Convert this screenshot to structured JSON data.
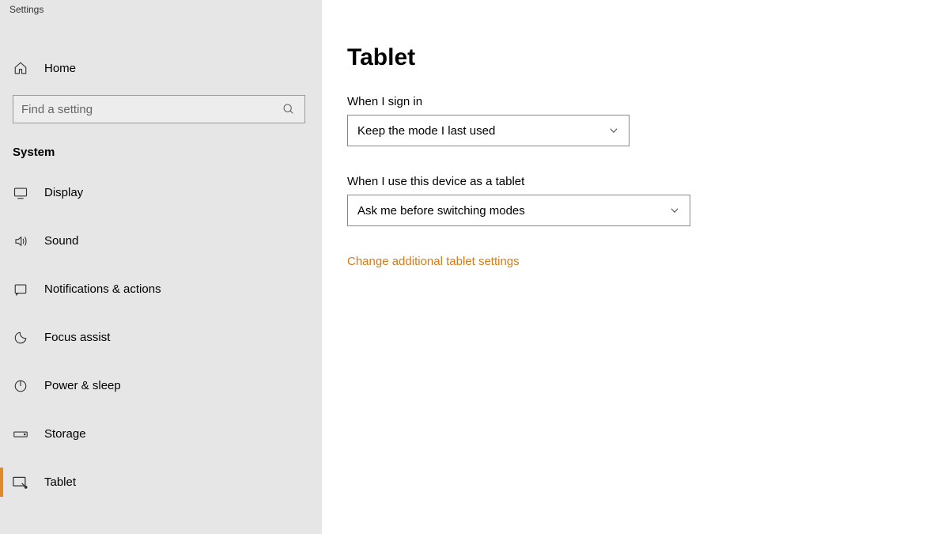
{
  "window": {
    "title": "Settings"
  },
  "sidebar": {
    "home_label": "Home",
    "search_placeholder": "Find a setting",
    "section_label": "System",
    "items": [
      {
        "label": "Display"
      },
      {
        "label": "Sound"
      },
      {
        "label": "Notifications & actions"
      },
      {
        "label": "Focus assist"
      },
      {
        "label": "Power & sleep"
      },
      {
        "label": "Storage"
      },
      {
        "label": "Tablet"
      }
    ]
  },
  "main": {
    "title": "Tablet",
    "signin_label": "When I sign in",
    "signin_value": "Keep the mode I last used",
    "device_label": "When I use this device as a tablet",
    "device_value": "Ask me before switching modes",
    "link_label": "Change additional tablet settings"
  }
}
